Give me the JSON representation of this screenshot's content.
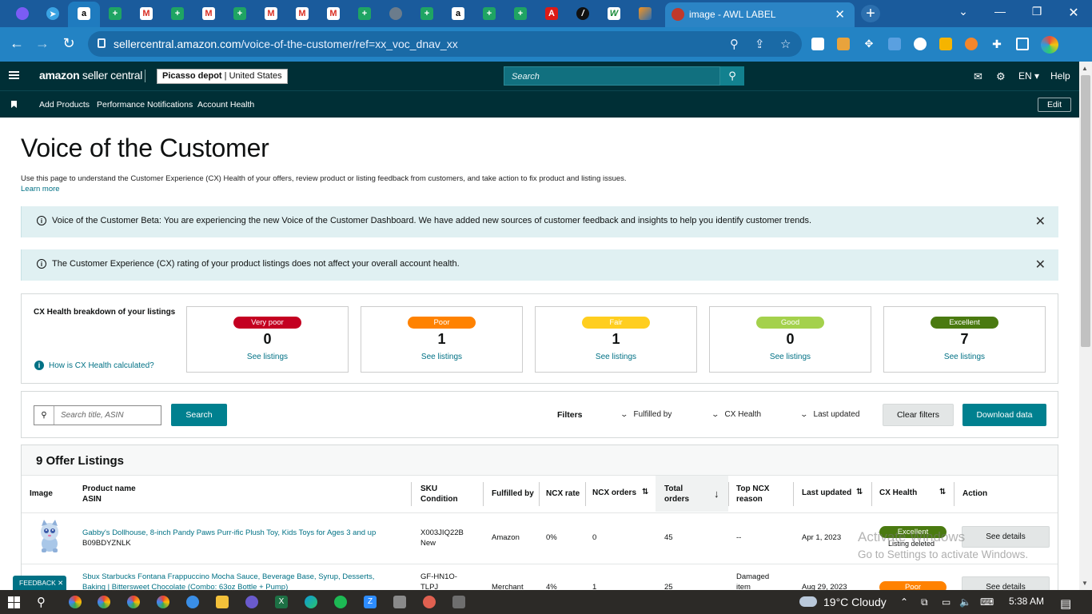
{
  "browser": {
    "active_tab_title": "image - AWL LABEL",
    "url_host": "sellercentral.amazon.com",
    "url_path": "/voice-of-the-customer/ref=xx_voc_dnav_xx"
  },
  "header": {
    "logo_text_1": "amazon",
    "logo_text_2": "seller central",
    "store_name": "Picasso depot",
    "store_region": "United States",
    "search_placeholder": "Search",
    "language": "EN",
    "help": "Help"
  },
  "subnav": {
    "items": [
      "Add Products",
      "Performance Notifications",
      "Account Health"
    ],
    "edit": "Edit"
  },
  "page": {
    "title": "Voice of the Customer",
    "description": "Use this page to understand the Customer Experience (CX) Health of your offers, review product or listing feedback from customers, and take action to fix product and listing issues.",
    "learn_more": "Learn more"
  },
  "banners": [
    {
      "text": "Voice of the Customer Beta: You are experiencing the new Voice of the Customer Dashboard. We have added new sources of customer feedback and insights to help you identify customer trends."
    },
    {
      "text": "The Customer Experience (CX) rating of your product listings does not affect your overall account health."
    }
  ],
  "cx_health": {
    "label": "CX Health breakdown of your listings",
    "how_link": "How is CX Health calculated?",
    "cards": [
      {
        "label": "Very poor",
        "count": "0",
        "link": "See listings",
        "color": "#c40021"
      },
      {
        "label": "Poor",
        "count": "1",
        "link": "See listings",
        "color": "#ff8200"
      },
      {
        "label": "Fair",
        "count": "1",
        "link": "See listings",
        "color": "#ffce1f"
      },
      {
        "label": "Good",
        "count": "0",
        "link": "See listings",
        "color": "#a4d14c"
      },
      {
        "label": "Excellent",
        "count": "7",
        "link": "See listings",
        "color": "#4a7a10"
      }
    ]
  },
  "filters": {
    "search_placeholder": "Search title, ASIN",
    "search_button": "Search",
    "filters_label": "Filters",
    "dropdowns": [
      "Fulfilled by",
      "CX Health",
      "Last updated"
    ],
    "clear_button": "Clear filters",
    "download_button": "Download data"
  },
  "table": {
    "title": "9 Offer Listings",
    "headers": {
      "image": "Image",
      "product_name": "Product name",
      "asin": "ASIN",
      "sku": "SKU",
      "condition": "Condition",
      "fulfilled_by": "Fulfilled by",
      "ncx_rate": "NCX rate",
      "ncx_orders": "NCX orders",
      "total": "Total",
      "orders": "orders",
      "top_ncx": "Top NCX",
      "reason": "reason",
      "last_updated": "Last updated",
      "cx_health": "CX Health",
      "action": "Action"
    },
    "rows": [
      {
        "product": "Gabby's Dollhouse, 8-inch Pandy Paws Purr-ific Plush Toy, Kids Toys for Ages 3 and up",
        "asin": "B09BDYZNLK",
        "sku": "X003JIQ22B",
        "condition": "New",
        "fulfilled": "Amazon",
        "ncx_rate": "0%",
        "ncx_orders": "0",
        "total_orders": "45",
        "top_reason": "--",
        "updated": "Apr 1, 2023",
        "health": "Excellent",
        "health_color": "#4a7a10",
        "health_note": "Listing deleted",
        "action": "See details"
      },
      {
        "product": "Sbux Starbucks Fontana Frappuccino Mocha Sauce, Beverage Base, Syrup, Desserts,",
        "product_2": "Baking | Bittersweet Chocolate (Combo: 63oz Bottle + Pump)",
        "sku": "GF-HN1O-",
        "sku_2": "TLPJ",
        "fulfilled": "Merchant",
        "ncx_rate": "4%",
        "ncx_orders": "1",
        "total_orders": "25",
        "top_reason": "Damaged",
        "top_reason_2": "item",
        "updated": "Aug 29, 2023",
        "health": "Poor",
        "health_color": "#ff8200",
        "action": "See details"
      }
    ]
  },
  "overlay": {
    "watermark_1": "Activate Windows",
    "watermark_2": "Go to Settings to activate Windows.",
    "feedback": "FEEDBACK ✕"
  },
  "taskbar": {
    "weather": "19°C  Cloudy",
    "time": "5:38 AM"
  }
}
